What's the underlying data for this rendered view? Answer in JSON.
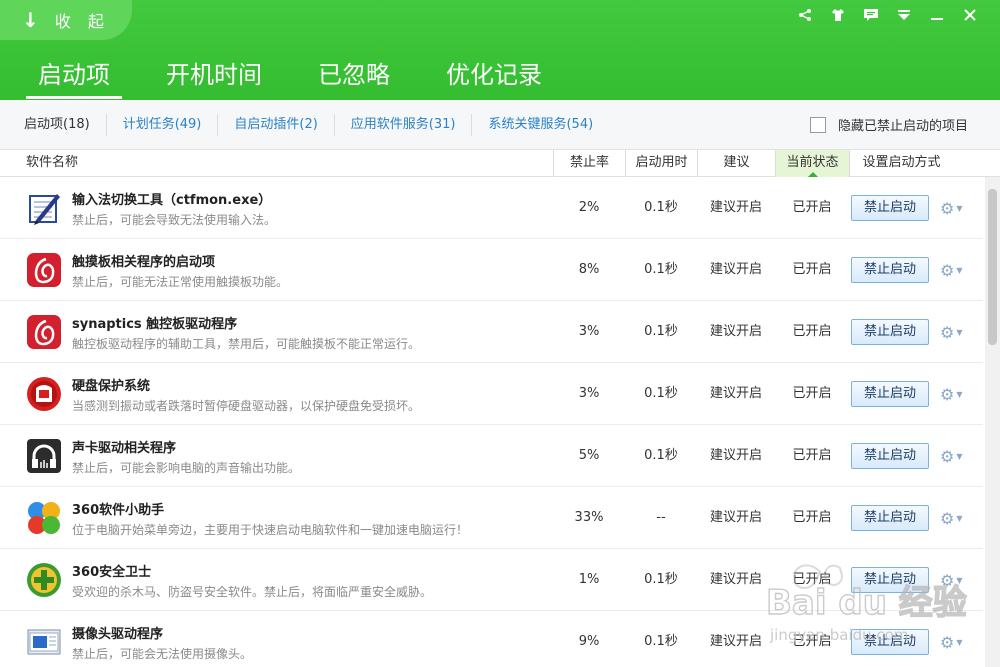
{
  "header": {
    "collapse_label": "收 起",
    "tabs": [
      {
        "label": "启动项"
      },
      {
        "label": "开机时间"
      },
      {
        "label": "已忽略"
      },
      {
        "label": "优化记录"
      }
    ]
  },
  "subtabs": [
    {
      "label": "启动项(18)"
    },
    {
      "label": "计划任务(49)"
    },
    {
      "label": "自启动插件(2)"
    },
    {
      "label": "应用软件服务(31)"
    },
    {
      "label": "系统关键服务(54)"
    }
  ],
  "hide_disabled_label": "隐藏已禁止启动的项目",
  "columns": {
    "name": "软件名称",
    "rate": "禁止率",
    "time": "启动用时",
    "advice": "建议",
    "state": "当前状态",
    "setting": "设置启动方式"
  },
  "action_label": "禁止启动",
  "rows": [
    {
      "name": "输入法切换工具（ctfmon.exe）",
      "desc": "禁止后，可能会导致无法使用输入法。",
      "rate": "2%",
      "time": "0.1秒",
      "advice": "建议开启",
      "state": "已开启",
      "icon": "pen-notepad-icon"
    },
    {
      "name": "触摸板相关程序的启动项",
      "desc": "禁止后，可能无法正常使用触摸板功能。",
      "rate": "8%",
      "time": "0.1秒",
      "advice": "建议开启",
      "state": "已开启",
      "icon": "synaptics-icon"
    },
    {
      "name": "synaptics 触控板驱动程序",
      "desc": "触控板驱动程序的辅助工具，禁用后，可能触摸板不能正常运行。",
      "rate": "3%",
      "time": "0.1秒",
      "advice": "建议开启",
      "state": "已开启",
      "icon": "synaptics-icon"
    },
    {
      "name": "硬盘保护系统",
      "desc": "当感测到振动或者跌落时暂停硬盘驱动器，以保护硬盘免受损坏。",
      "rate": "3%",
      "time": "0.1秒",
      "advice": "建议开启",
      "state": "已开启",
      "icon": "disk-protect-icon"
    },
    {
      "name": "声卡驱动相关程序",
      "desc": "禁止后，可能会影响电脑的声音输出功能。",
      "rate": "5%",
      "time": "0.1秒",
      "advice": "建议开启",
      "state": "已开启",
      "icon": "headphone-icon"
    },
    {
      "name": "360软件小助手",
      "desc": "位于电脑开始菜单旁边，主要用于快速启动电脑软件和一键加速电脑运行！",
      "rate": "33%",
      "time": "--",
      "advice": "建议开启",
      "state": "已开启",
      "icon": "360-helper-icon"
    },
    {
      "name": "360安全卫士",
      "desc": "受欢迎的杀木马、防盗号安全软件。禁止后，将面临严重安全威胁。",
      "rate": "1%",
      "time": "0.1秒",
      "advice": "建议开启",
      "state": "已开启",
      "icon": "360-safe-icon"
    },
    {
      "name": "摄像头驱动程序",
      "desc": "禁止后，可能会无法使用摄像头。",
      "rate": "9%",
      "time": "0.1秒",
      "advice": "建议开启",
      "state": "已开启",
      "icon": "camera-driver-icon"
    }
  ],
  "watermark": {
    "brand": "Bai du 经验",
    "url": "jingyan.baidu.com"
  }
}
